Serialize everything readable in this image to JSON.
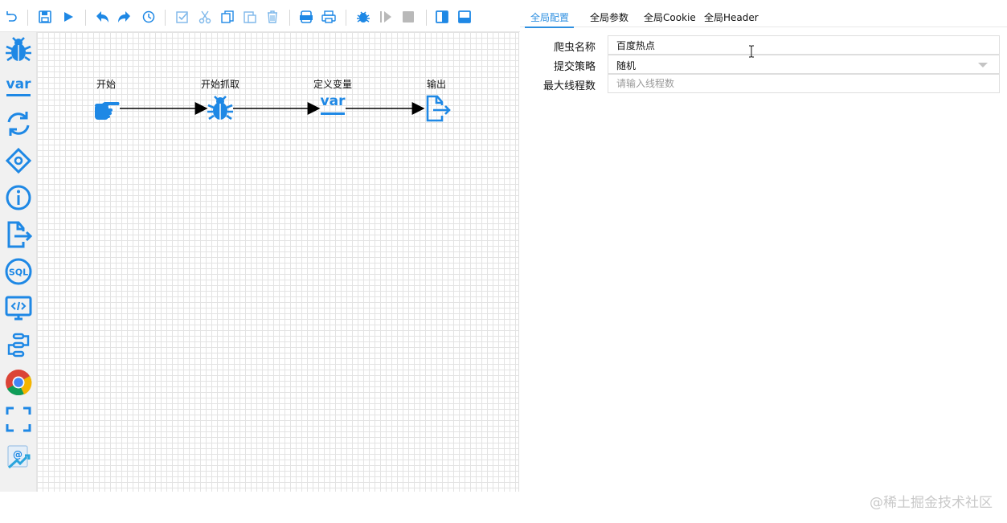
{
  "toolbar": {
    "buttons": [
      "undo-icon",
      "save-icon",
      "run-icon",
      "undo-arrow-icon",
      "redo-arrow-icon",
      "history-icon",
      "select-all-icon",
      "cut-icon",
      "copy-icon",
      "paste-icon",
      "delete-icon",
      "export-icon",
      "print-icon",
      "debug-icon",
      "resume-icon",
      "stop-icon",
      "right-panel-icon",
      "bottom-panel-icon"
    ]
  },
  "palette": {
    "items": [
      {
        "icon": "spider-icon"
      },
      {
        "icon": "variable-icon",
        "text": "var"
      },
      {
        "icon": "loop-icon"
      },
      {
        "icon": "condition-icon"
      },
      {
        "icon": "info-icon"
      },
      {
        "icon": "output-icon"
      },
      {
        "icon": "sql-icon",
        "text": "SQL"
      },
      {
        "icon": "code-icon"
      },
      {
        "icon": "process-icon"
      },
      {
        "icon": "chrome-icon"
      },
      {
        "icon": "screenshot-icon"
      },
      {
        "icon": "email-icon",
        "text": "@"
      }
    ]
  },
  "flow": {
    "nodes": [
      {
        "label": "开始",
        "icon": "hand-pointer-icon"
      },
      {
        "label": "开始抓取",
        "icon": "spider-icon"
      },
      {
        "label": "定义变量",
        "icon": "variable-icon",
        "text": "var"
      },
      {
        "label": "输出",
        "icon": "output-icon"
      }
    ]
  },
  "panel": {
    "tabs": [
      {
        "label": "全局配置",
        "active": true
      },
      {
        "label": "全局参数",
        "active": false
      },
      {
        "label": "全局Cookie",
        "active": false
      },
      {
        "label": "全局Header",
        "active": false
      }
    ],
    "fields": {
      "name": {
        "label": "爬虫名称",
        "value": "百度热点"
      },
      "strategy": {
        "label": "提交策略",
        "value": "随机"
      },
      "threads": {
        "label": "最大线程数",
        "value": "",
        "placeholder": "请输入线程数"
      }
    }
  },
  "colors": {
    "accent": "#2e8fe0",
    "icon_blue": "#1e88e5",
    "grid": "#e3e3e3"
  },
  "watermark": "@稀土掘金技术社区"
}
